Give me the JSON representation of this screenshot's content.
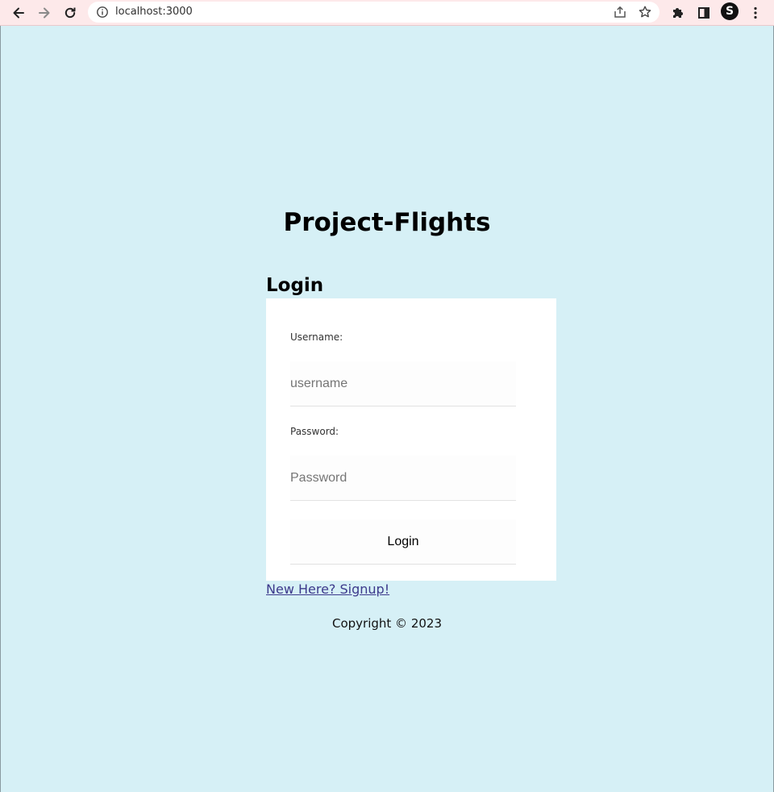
{
  "browser": {
    "url": "localhost:3000",
    "profile_initial": "S",
    "icons": {
      "back": "arrow-left-icon",
      "forward": "arrow-right-icon",
      "reload": "reload-icon",
      "info": "info-icon",
      "share": "share-icon",
      "bookmark": "star-icon",
      "extensions": "puzzle-icon",
      "side_panel": "side-panel-icon",
      "menu": "kebab-menu-icon"
    }
  },
  "page": {
    "site_title": "Project-Flights",
    "login_heading": "Login",
    "form": {
      "username_label": "Username:",
      "username_placeholder": "username",
      "username_value": "",
      "password_label": "Password:",
      "password_placeholder": "Password",
      "password_value": "",
      "submit_label": "Login"
    },
    "signup_link": "New Here? Signup!",
    "copyright": "Copyright © 2023"
  },
  "colors": {
    "page_background": "#d6f0f6",
    "toolbar_background": "#fde9ea",
    "card_background": "#ffffff",
    "link": "#3d3a8c"
  }
}
